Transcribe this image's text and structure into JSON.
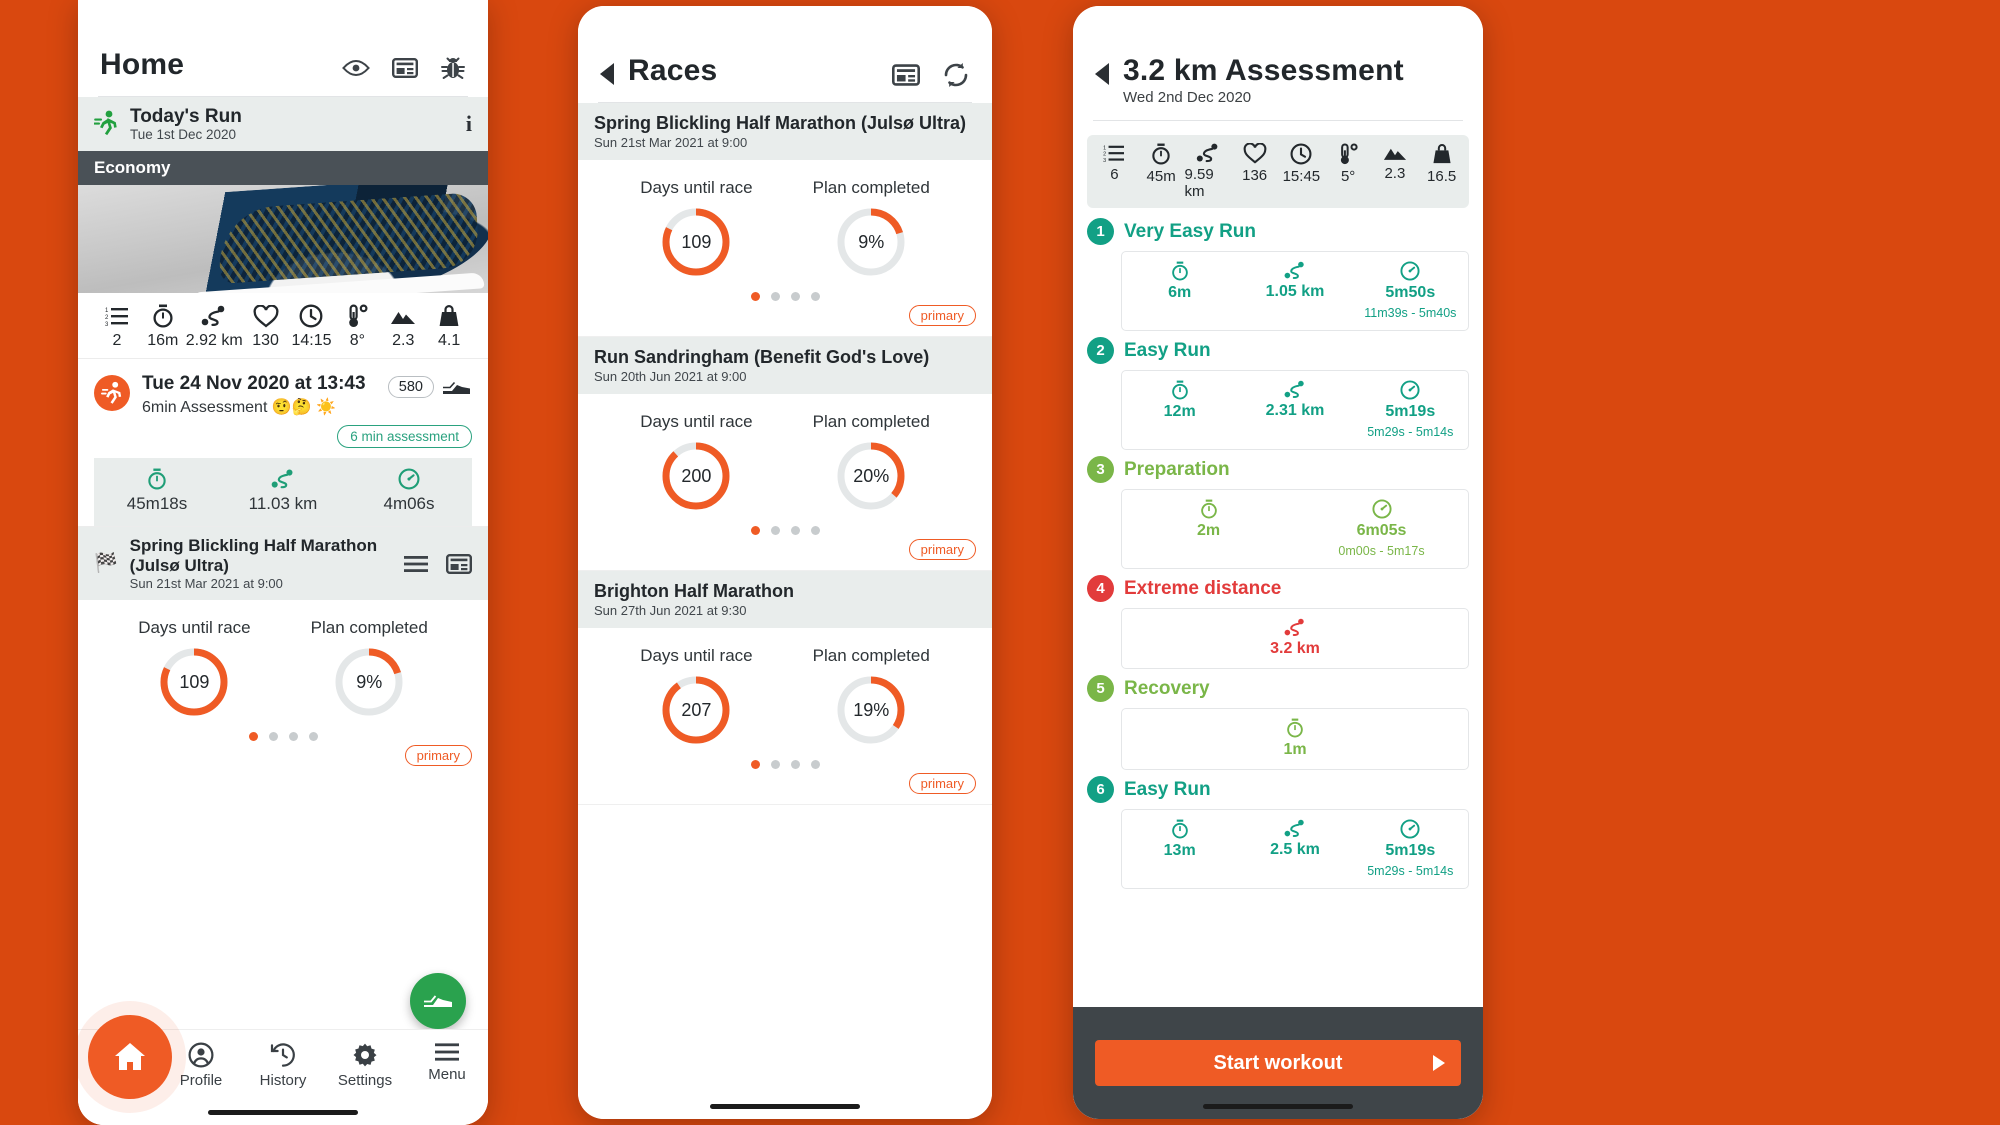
{
  "theme": {
    "background": "#d9480f",
    "accent": "#ef5b25",
    "teal": "#1f9e77",
    "dark": "#3f4549"
  },
  "phone_home": {
    "header": {
      "title": "Home",
      "icons": [
        "eye-icon",
        "card-icon",
        "bug-icon"
      ]
    },
    "todays_run": {
      "label": "Today's Run",
      "date": "Tue 1st Dec 2020",
      "info": "i",
      "banner": "Economy"
    },
    "metrics": [
      {
        "icon": "list-icon",
        "value": "2"
      },
      {
        "icon": "stopwatch-icon",
        "value": "16m"
      },
      {
        "icon": "route-icon",
        "value": "2.92 km"
      },
      {
        "icon": "heart-icon",
        "value": "130"
      },
      {
        "icon": "clock-icon",
        "value": "14:15"
      },
      {
        "icon": "thermometer-icon",
        "value": "8°"
      },
      {
        "icon": "mountain-icon",
        "value": "2.3"
      },
      {
        "icon": "weight-icon",
        "value": "4.1"
      }
    ],
    "entry": {
      "title": "Tue 24 Nov 2020 at 13:43",
      "subtitle": "6min Assessment 🤨🤔 ☀️",
      "score": "580",
      "shoe_icon": "shoe-icon",
      "tag": "6 min assessment",
      "stats": [
        {
          "icon": "stopwatch-icon",
          "value": "45m18s"
        },
        {
          "icon": "route-icon",
          "value": "11.03 km"
        },
        {
          "icon": "speed-icon",
          "value": "4m06s"
        }
      ]
    },
    "race": {
      "flag": "🏁",
      "name": "Spring Blickling Half Marathon (Julsø Ultra)",
      "date": "Sun 21st Mar 2021 at 9:00",
      "icons": [
        "list-lines-icon",
        "card-icon"
      ],
      "rings": [
        {
          "label": "Days until race",
          "value": "109",
          "percent": 82
        },
        {
          "label": "Plan completed",
          "value": "9%",
          "percent": 9
        }
      ],
      "dots": 4,
      "active_dot": 0,
      "tag": "primary"
    },
    "fab": "shoe-icon",
    "tabs": [
      {
        "label": "",
        "icon": "home-icon"
      },
      {
        "label": "Profile",
        "icon": "profile-icon"
      },
      {
        "label": "History",
        "icon": "history-icon"
      },
      {
        "label": "Settings",
        "icon": "gear-icon"
      },
      {
        "label": "Menu",
        "icon": "menu-icon"
      }
    ]
  },
  "phone_races": {
    "header": {
      "title": "Races",
      "back": "back-caret-icon",
      "icons": [
        "card-icon",
        "refresh-icon"
      ]
    },
    "cards": [
      {
        "title": "Spring Blickling Half Marathon (Julsø Ultra)",
        "date": "Sun 21st Mar 2021 at 9:00",
        "rings": [
          {
            "label": "Days until race",
            "value": "109",
            "percent": 82
          },
          {
            "label": "Plan completed",
            "value": "9%",
            "percent": 9
          }
        ],
        "dots": 4,
        "active_dot": 0,
        "tag": "primary"
      },
      {
        "title": "Run Sandringham (Benefit God's Love)",
        "date": "Sun 20th Jun 2021 at 9:00",
        "rings": [
          {
            "label": "Days until race",
            "value": "200",
            "percent": 88
          },
          {
            "label": "Plan completed",
            "value": "20%",
            "percent": 20
          }
        ],
        "dots": 4,
        "active_dot": 0,
        "tag": "primary"
      },
      {
        "title": "Brighton Half Marathon",
        "date": "Sun 27th Jun 2021 at 9:30",
        "rings": [
          {
            "label": "Days until race",
            "value": "207",
            "percent": 90
          },
          {
            "label": "Plan completed",
            "value": "19%",
            "percent": 19
          }
        ],
        "dots": 4,
        "active_dot": 0,
        "tag": "primary"
      }
    ]
  },
  "phone_workout": {
    "header": {
      "title": "3.2 km Assessment",
      "subtitle": "Wed 2nd Dec 2020",
      "back": "back-caret-icon"
    },
    "metrics": [
      {
        "icon": "list-icon",
        "value": "6"
      },
      {
        "icon": "stopwatch-icon",
        "value": "45m"
      },
      {
        "icon": "route-icon",
        "value": "9.59 km"
      },
      {
        "icon": "heart-icon",
        "value": "136"
      },
      {
        "icon": "clock-icon",
        "value": "15:45"
      },
      {
        "icon": "thermometer-icon",
        "value": "5°"
      },
      {
        "icon": "mountain-icon",
        "value": "2.3"
      },
      {
        "icon": "weight-icon",
        "value": "16.5"
      }
    ],
    "steps": [
      {
        "num": "1",
        "name": "Very Easy Run",
        "color": "#12a085",
        "cells": [
          {
            "icon": "stopwatch-icon",
            "value": "6m",
            "range": ""
          },
          {
            "icon": "route-icon",
            "value": "1.05 km",
            "range": ""
          },
          {
            "icon": "speed-icon",
            "value": "5m50s",
            "range": "11m39s - 5m40s"
          }
        ]
      },
      {
        "num": "2",
        "name": "Easy Run",
        "color": "#12a085",
        "cells": [
          {
            "icon": "stopwatch-icon",
            "value": "12m",
            "range": ""
          },
          {
            "icon": "route-icon",
            "value": "2.31 km",
            "range": ""
          },
          {
            "icon": "speed-icon",
            "value": "5m19s",
            "range": "5m29s - 5m14s"
          }
        ]
      },
      {
        "num": "3",
        "name": "Preparation",
        "color": "#7ab648",
        "cells": [
          {
            "icon": "stopwatch-icon",
            "value": "2m",
            "range": ""
          },
          {
            "icon": "speed-icon",
            "value": "6m05s",
            "range": "0m00s - 5m17s"
          }
        ]
      },
      {
        "num": "4",
        "name": "Extreme distance",
        "color": "#e23b3b",
        "cells": [
          {
            "icon": "route-icon",
            "value": "3.2 km",
            "range": ""
          }
        ]
      },
      {
        "num": "5",
        "name": "Recovery",
        "color": "#7ab648",
        "cells": [
          {
            "icon": "stopwatch-icon",
            "value": "1m",
            "range": ""
          }
        ]
      },
      {
        "num": "6",
        "name": "Easy Run",
        "color": "#12a085",
        "cells": [
          {
            "icon": "stopwatch-icon",
            "value": "13m",
            "range": ""
          },
          {
            "icon": "route-icon",
            "value": "2.5 km",
            "range": ""
          },
          {
            "icon": "speed-icon",
            "value": "5m19s",
            "range": "5m29s - 5m14s"
          }
        ]
      }
    ],
    "start_button": "Start workout"
  }
}
